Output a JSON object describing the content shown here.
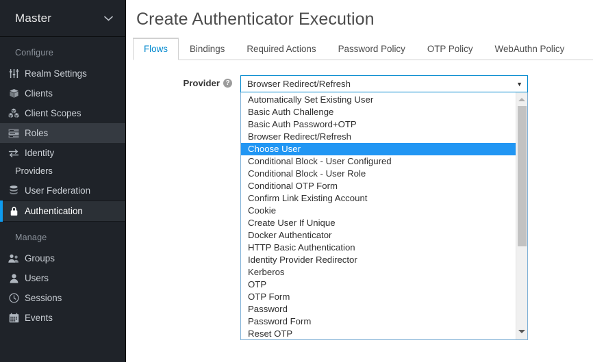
{
  "sidebar": {
    "realm": {
      "name": "Master",
      "chevron_icon": "chevron-down-icon"
    },
    "sections": [
      {
        "label": "Configure",
        "items": [
          {
            "label": "Realm Settings",
            "icon": "sliders-icon",
            "state": "normal"
          },
          {
            "label": "Clients",
            "icon": "cube-icon",
            "state": "normal"
          },
          {
            "label": "Client Scopes",
            "icon": "cubes-icon",
            "state": "normal"
          },
          {
            "label": "Roles",
            "icon": "list-icon",
            "state": "hover"
          },
          {
            "label": "Identity",
            "icon": "exchange-icon",
            "state": "normal"
          }
        ],
        "sub_label": "Providers",
        "sub_items": [
          {
            "label": "User Federation",
            "icon": "database-icon",
            "state": "normal"
          },
          {
            "label": "Authentication",
            "icon": "lock-icon",
            "state": "active"
          }
        ]
      },
      {
        "label": "Manage",
        "items": [
          {
            "label": "Groups",
            "icon": "users-icon",
            "state": "normal"
          },
          {
            "label": "Users",
            "icon": "user-icon",
            "state": "normal"
          },
          {
            "label": "Sessions",
            "icon": "clock-icon",
            "state": "normal"
          },
          {
            "label": "Events",
            "icon": "calendar-icon",
            "state": "normal"
          }
        ],
        "sub_label": "",
        "sub_items": []
      }
    ]
  },
  "main": {
    "page_title": "Create Authenticator Execution",
    "tabs": [
      {
        "label": "Flows",
        "active": true
      },
      {
        "label": "Bindings",
        "active": false
      },
      {
        "label": "Required Actions",
        "active": false
      },
      {
        "label": "Password Policy",
        "active": false
      },
      {
        "label": "OTP Policy",
        "active": false
      },
      {
        "label": "WebAuthn Policy",
        "active": false
      }
    ],
    "form": {
      "provider_label": "Provider",
      "help_icon": "help-circle-icon",
      "help_glyph": "?",
      "select_value": "Browser Redirect/Refresh",
      "select_arrow_glyph": "▼",
      "selected_option": "Choose User",
      "options": [
        "Automatically Set Existing User",
        "Basic Auth Challenge",
        "Basic Auth Password+OTP",
        "Browser Redirect/Refresh",
        "Choose User",
        "Conditional Block - User Configured",
        "Conditional Block - User Role",
        "Conditional OTP Form",
        "Confirm Link Existing Account",
        "Cookie",
        "Create User If Unique",
        "Docker Authenticator",
        "HTTP Basic Authentication",
        "Identity Provider Redirector",
        "Kerberos",
        "OTP",
        "OTP Form",
        "Password",
        "Password Form",
        "Reset OTP"
      ],
      "scrollbar": {
        "up_icon": "scroll-up-arrow-icon",
        "down_icon": "scroll-down-arrow-icon"
      }
    }
  },
  "colors": {
    "sidebar_bg": "#1f2329",
    "accent_blue": "#0e9bf0",
    "tab_active_text": "#0088ce",
    "option_selected_bg": "#2196f3",
    "focus_border": "#0088ce"
  }
}
